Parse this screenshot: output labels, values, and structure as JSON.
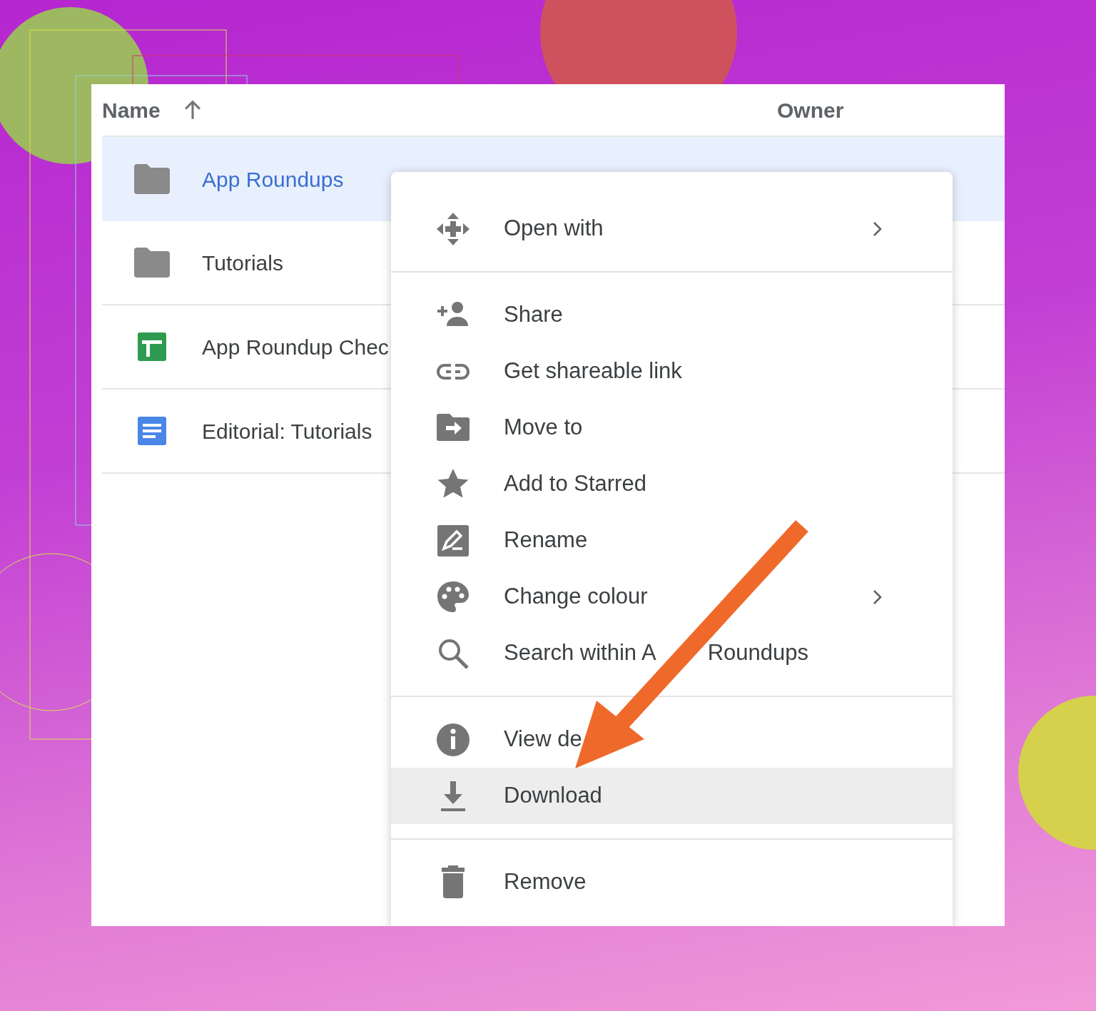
{
  "columns": [
    {
      "label": "Name",
      "sorted": true
    },
    {
      "label": "Owner",
      "sorted": false
    }
  ],
  "files": [
    {
      "name": "App Roundups",
      "kind": "folder",
      "selected": true
    },
    {
      "name": "Tutorials",
      "kind": "folder",
      "selected": false
    },
    {
      "name": "App Roundup Chec",
      "kind": "sheet",
      "selected": false
    },
    {
      "name": "Editorial: Tutorials",
      "kind": "doc",
      "selected": false
    }
  ],
  "context_menu": {
    "groups": [
      {
        "items": [
          {
            "label": "Open with",
            "submenu": true,
            "selected": false
          }
        ]
      },
      {
        "items": [
          {
            "label": "Share",
            "submenu": false,
            "selected": false
          },
          {
            "label": "Get shareable link",
            "submenu": false,
            "selected": false
          },
          {
            "label": "Move to",
            "submenu": false,
            "selected": false
          },
          {
            "label": "Add to Starred",
            "submenu": false,
            "selected": false
          },
          {
            "label": "Rename",
            "submenu": false,
            "selected": false
          },
          {
            "label": "Change colour",
            "submenu": true,
            "selected": false
          },
          {
            "label_parts": [
              "Search within A",
              "Roundups"
            ],
            "submenu": false,
            "selected": false
          }
        ]
      },
      {
        "items": [
          {
            "label": "View de",
            "submenu": false,
            "selected": false
          },
          {
            "label": "Download",
            "submenu": false,
            "selected": true
          }
        ]
      },
      {
        "items": [
          {
            "label": "Remove",
            "submenu": false,
            "selected": false
          }
        ]
      }
    ]
  }
}
